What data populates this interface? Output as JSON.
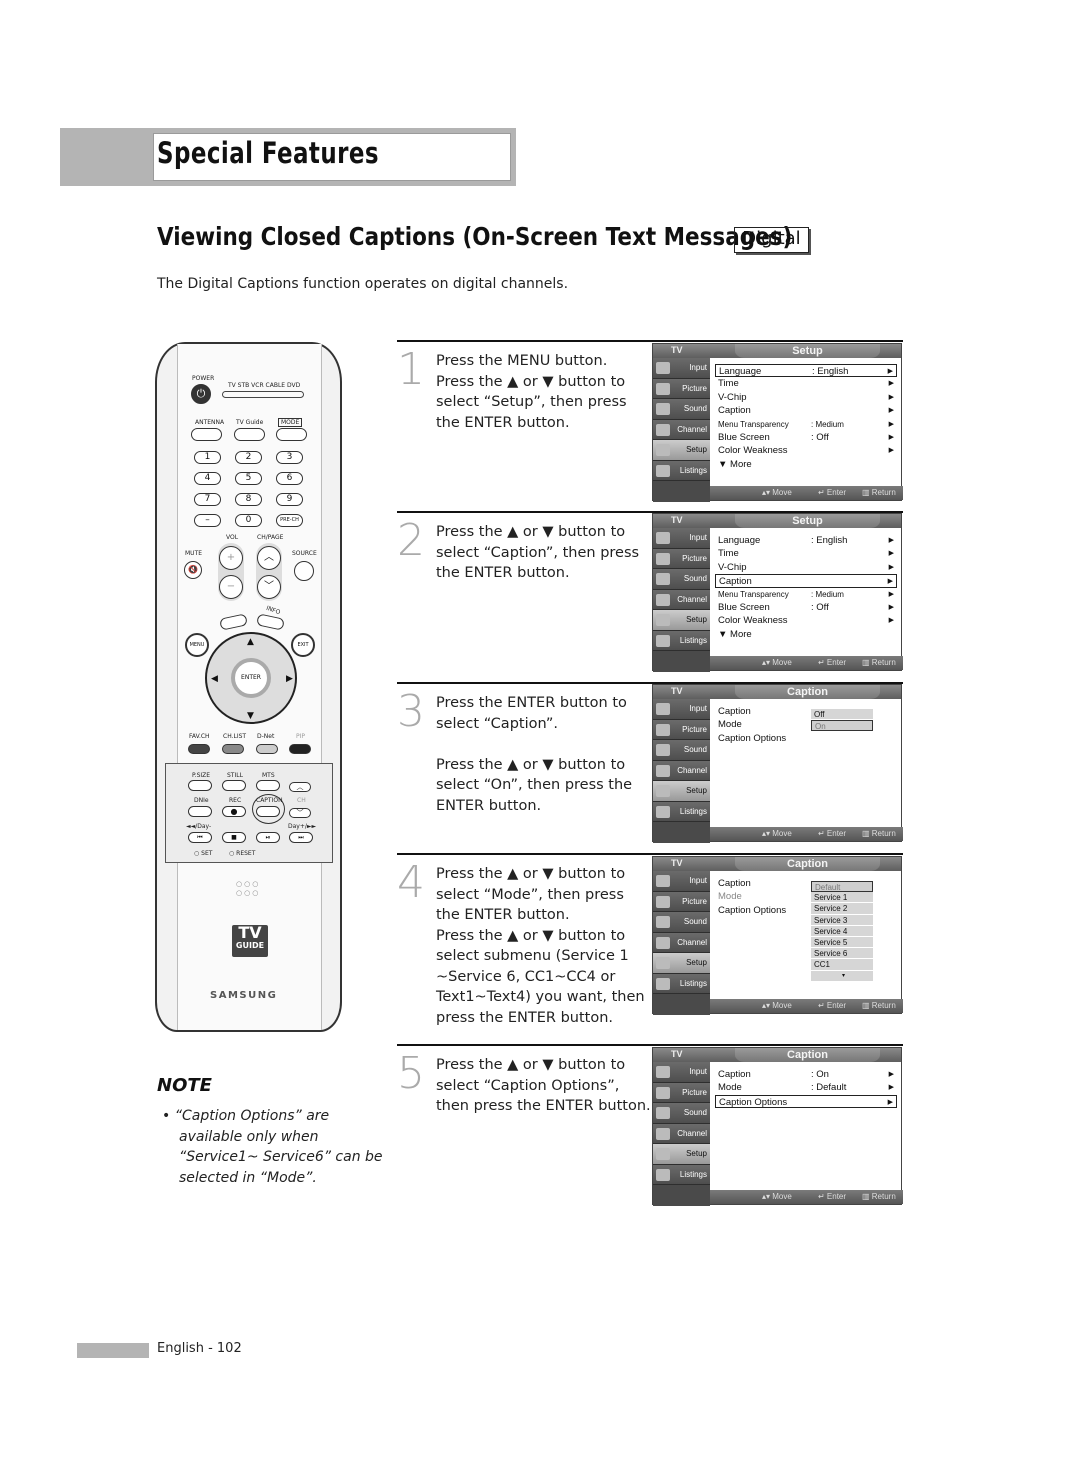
{
  "section": "Special Features",
  "title": "Viewing Closed Captions (On-Screen Text Messages)",
  "badge": "Digital",
  "intro": "The Digital Captions function operates on digital channels.",
  "remote": {
    "power": "POWER",
    "modes": "TV  STB  VCR  CABLE  DVD",
    "antenna": "ANTENNA",
    "tvguide": "TV Guide",
    "mode": "MODE",
    "digits": [
      "1",
      "2",
      "3",
      "4",
      "5",
      "6",
      "7",
      "8",
      "9",
      "–",
      "0",
      "PRE-CH"
    ],
    "vol": "VOL",
    "chpage": "CH/PAGE",
    "mute": "MUTE",
    "source": "SOURCE",
    "menu": "MENU",
    "info": "INFO",
    "exit": "EXIT",
    "enter": "ENTER",
    "favch": "FAV.CH",
    "chlist": "CH.LIST",
    "dnet": "D-Net",
    "pip": "PIP",
    "psize": "P.SIZE",
    "still": "STILL",
    "mts": "MTS",
    "dnie": "DNIe",
    "rec": "REC",
    "caption": "CAPTION",
    "ch": "CH",
    "dayback": "◄◄/Day-",
    "dayfwd": "Day+/►►",
    "set": "SET",
    "reset": "RESET",
    "logo_tv": "TV",
    "logo_guide": "GUIDE",
    "brand": "SAMSUNG"
  },
  "note": {
    "title": "NOTE",
    "text": "•  “Caption Options” are available only when “Service1~ Service6” can be selected in “Mode”."
  },
  "steps": [
    {
      "num": "1",
      "text": "Press the MENU button.\nPress the ▲ or ▼ button to select “Setup”, then press the ENTER button."
    },
    {
      "num": "2",
      "text": "Press the ▲ or ▼ button to select “Caption”, then press the ENTER button."
    },
    {
      "num": "3",
      "text": "Press the ENTER button to select “Caption”.\n\nPress the ▲ or ▼ button to select “On”, then press the ENTER button."
    },
    {
      "num": "4",
      "text": "Press the ▲ or ▼ button to select “Mode”, then press the ENTER button.\nPress the ▲ or ▼ button to select submenu (Service 1 ~Service 6, CC1~CC4 or Text1~Text4) you want, then press the ENTER button."
    },
    {
      "num": "5",
      "text": "Press the ▲ or ▼ button to select “Caption Options”, then press the ENTER button."
    }
  ],
  "osd": {
    "tv": "TV",
    "tabs": [
      "Input",
      "Picture",
      "Sound",
      "Channel",
      "Setup",
      "Listings"
    ],
    "move": "▴▾ Move",
    "enter": "↵ Enter",
    "return": "▥ Return",
    "screens": [
      {
        "title": "Setup",
        "rows": [
          {
            "label": "Language",
            "value": ": English",
            "arrow": "▶"
          },
          {
            "label": "Time",
            "value": "",
            "arrow": "▶"
          },
          {
            "label": "V-Chip",
            "value": "",
            "arrow": "▶"
          },
          {
            "label": "Caption",
            "value": "",
            "arrow": "▶"
          },
          {
            "label": "Menu Transparency",
            "value": ": Medium",
            "arrow": "▶"
          },
          {
            "label": "Blue Screen",
            "value": ": Off",
            "arrow": "▶"
          },
          {
            "label": "Color Weakness",
            "value": "",
            "arrow": "▶"
          },
          {
            "label": "▼ More",
            "value": "",
            "arrow": ""
          }
        ]
      },
      {
        "title": "Setup",
        "rows": [
          {
            "label": "Language",
            "value": ": English",
            "arrow": "▶"
          },
          {
            "label": "Time",
            "value": "",
            "arrow": "▶"
          },
          {
            "label": "V-Chip",
            "value": "",
            "arrow": "▶"
          },
          {
            "label": "Caption",
            "value": "",
            "arrow": "▶"
          },
          {
            "label": "Menu Transparency",
            "value": ": Medium",
            "arrow": "▶"
          },
          {
            "label": "Blue Screen",
            "value": ": Off",
            "arrow": "▶"
          },
          {
            "label": "Color Weakness",
            "value": "",
            "arrow": "▶"
          },
          {
            "label": "▼ More",
            "value": "",
            "arrow": ""
          }
        ]
      },
      {
        "title": "Caption",
        "rows": [
          {
            "label": "Caption"
          },
          {
            "label": "Mode"
          },
          {
            "label": "Caption Options"
          }
        ],
        "options": [
          "Off",
          "On"
        ]
      },
      {
        "title": "Caption",
        "rows": [
          {
            "label": "Caption"
          },
          {
            "label": "Mode"
          },
          {
            "label": "Caption Options"
          }
        ],
        "options": [
          "Default",
          "Service 1",
          "Service 2",
          "Service 3",
          "Service 4",
          "Service 5",
          "Service 6",
          "CC1",
          "▾"
        ]
      },
      {
        "title": "Caption",
        "rows": [
          {
            "label": "Caption",
            "value": ": On",
            "arrow": "▶"
          },
          {
            "label": "Mode",
            "value": ": Default",
            "arrow": "▶"
          },
          {
            "label": "Caption Options",
            "value": "",
            "arrow": "▶"
          }
        ]
      }
    ]
  },
  "footer": "English - 102"
}
